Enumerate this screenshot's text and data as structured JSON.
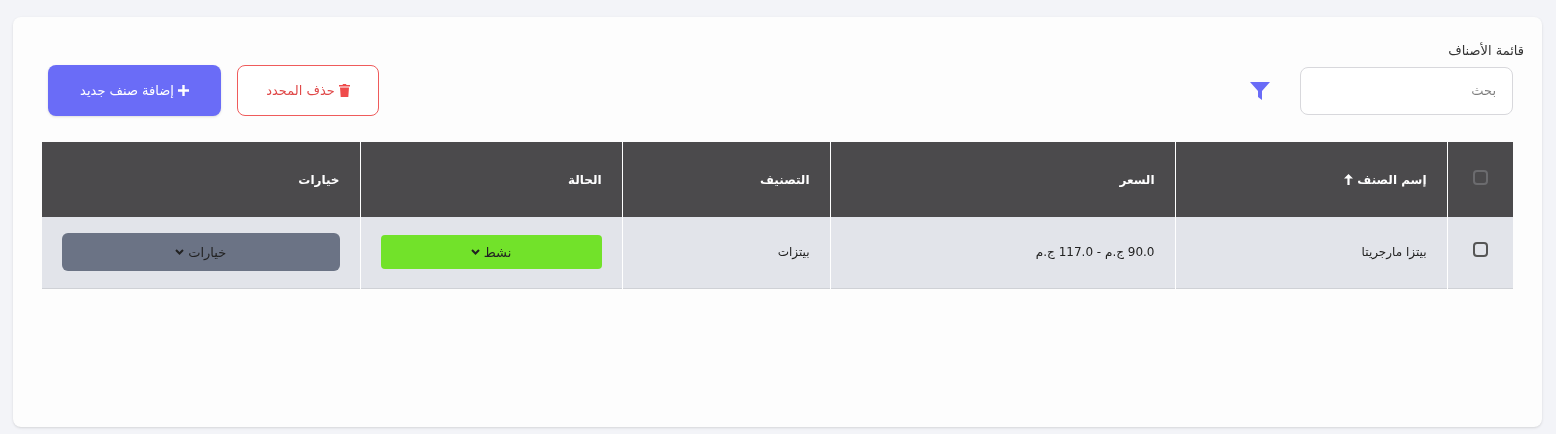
{
  "title": "قائمة الأصناف",
  "search": {
    "placeholder": "بحث"
  },
  "buttons": [
    {
      "kind": "delete",
      "label": "حذف المحدد"
    },
    {
      "kind": "add",
      "label": "إضافة صنف جديد"
    }
  ],
  "table": {
    "select_all": {
      "checked": false
    },
    "columns": [
      {
        "label": "إسم الصنف",
        "sorted": true
      },
      {
        "label": "السعر"
      },
      {
        "label": "التصنيف"
      },
      {
        "label": "الحالة"
      },
      {
        "label": "خيارات"
      }
    ],
    "rows": [
      {
        "checked": false,
        "name": "بيتزا مارجريتا",
        "price": "90.0 ج.م - 117.0 ج.م",
        "category": "بيتزات",
        "status": {
          "label": "نشط",
          "active": true
        },
        "options": "خيارات"
      }
    ]
  }
}
